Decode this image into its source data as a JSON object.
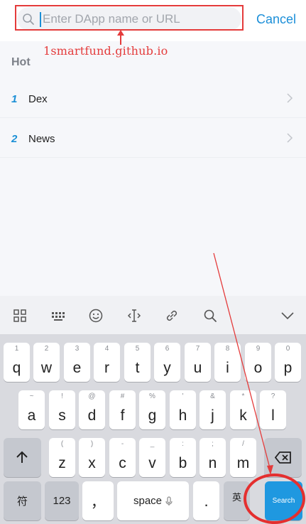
{
  "search": {
    "placeholder": "Enter DApp name or URL",
    "cancel_label": "Cancel"
  },
  "annotation": {
    "url_text": "1smartfund.github.io",
    "color": "#e43b3b"
  },
  "hot": {
    "title": "Hot",
    "items": [
      {
        "num": "1",
        "name": "Dex"
      },
      {
        "num": "2",
        "name": "News"
      }
    ]
  },
  "keyboard": {
    "toolbar_icons": [
      "grid-icon",
      "keyboard-layout-icon",
      "emoji-icon",
      "text-cursor-icon",
      "link-icon",
      "search-icon",
      "collapse-chevron-icon"
    ],
    "row1": [
      {
        "key": "q",
        "sup": "1"
      },
      {
        "key": "w",
        "sup": "2"
      },
      {
        "key": "e",
        "sup": "3"
      },
      {
        "key": "r",
        "sup": "4"
      },
      {
        "key": "t",
        "sup": "5"
      },
      {
        "key": "y",
        "sup": "6"
      },
      {
        "key": "u",
        "sup": "7"
      },
      {
        "key": "i",
        "sup": "8"
      },
      {
        "key": "o",
        "sup": "9"
      },
      {
        "key": "p",
        "sup": "0"
      }
    ],
    "row2": [
      {
        "key": "a",
        "sup": "~"
      },
      {
        "key": "s",
        "sup": "!"
      },
      {
        "key": "d",
        "sup": "@"
      },
      {
        "key": "f",
        "sup": "#"
      },
      {
        "key": "g",
        "sup": "%"
      },
      {
        "key": "h",
        "sup": "'"
      },
      {
        "key": "j",
        "sup": "&"
      },
      {
        "key": "k",
        "sup": "*"
      },
      {
        "key": "l",
        "sup": "?"
      }
    ],
    "row3": [
      {
        "key": "z",
        "sup": "("
      },
      {
        "key": "x",
        "sup": ")"
      },
      {
        "key": "c",
        "sup": "-"
      },
      {
        "key": "v",
        "sup": "_"
      },
      {
        "key": "b",
        "sup": ":"
      },
      {
        "key": "n",
        "sup": ";"
      },
      {
        "key": "m",
        "sup": "/"
      }
    ],
    "symbols_label": "符",
    "numbers_label": "123",
    "comma_label": "，",
    "space_label": "space",
    "period_label": ".",
    "lang_label": "英",
    "search_label": "Search",
    "accent_color": "#1f98e0"
  }
}
